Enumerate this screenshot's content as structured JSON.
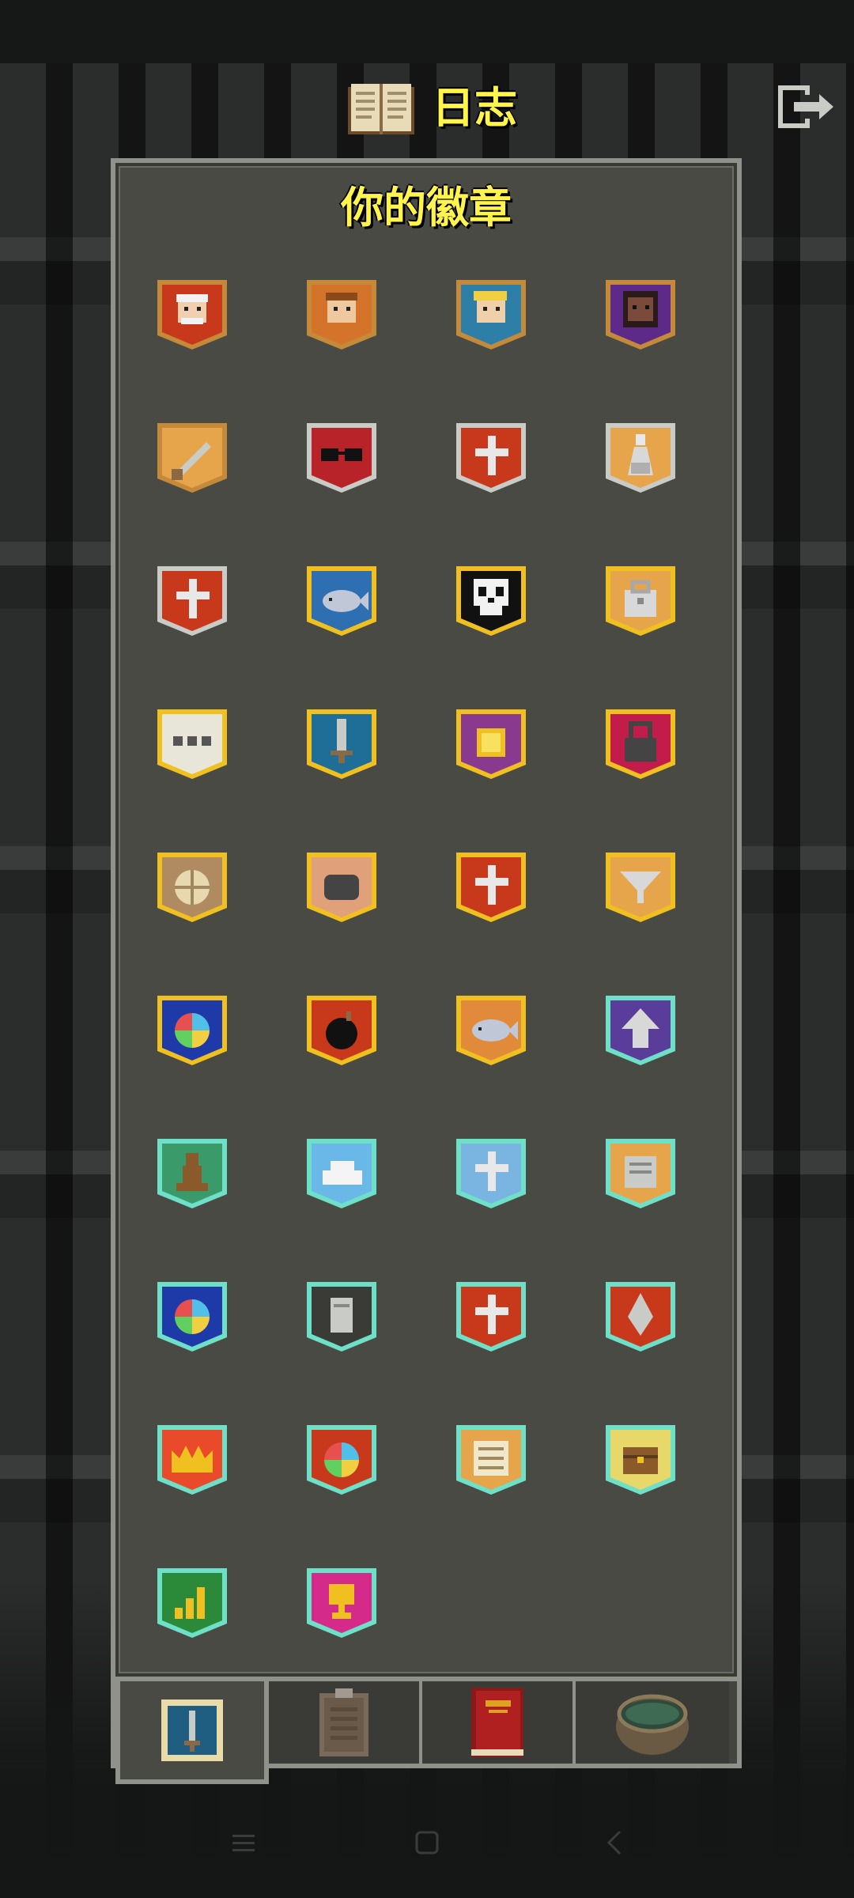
{
  "header": {
    "title": "日志",
    "book_icon": "journal-book-icon",
    "exit_icon": "exit-icon"
  },
  "panel": {
    "title": "你的徽章"
  },
  "badges": [
    {
      "name": "warrior-portrait-badge",
      "frame": "bronze",
      "bg": "#c8391b",
      "icon": "white-hair-face"
    },
    {
      "name": "mage-portrait-badge",
      "frame": "bronze",
      "bg": "#d4742a",
      "icon": "brown-hair-face"
    },
    {
      "name": "rogue-portrait-badge",
      "frame": "bronze",
      "bg": "#2d7fa8",
      "icon": "blond-face"
    },
    {
      "name": "huntress-portrait-badge",
      "frame": "bronze",
      "bg": "#5d2a8a",
      "icon": "dark-face"
    },
    {
      "name": "sword-badge",
      "frame": "bronze",
      "bg": "#e6a54a",
      "icon": "sword"
    },
    {
      "name": "glasses-badge",
      "frame": "silver",
      "bg": "#b8232a",
      "icon": "glasses"
    },
    {
      "name": "cross-silver-badge",
      "frame": "silver",
      "bg": "#c8391b",
      "icon": "cross"
    },
    {
      "name": "potion-badge",
      "frame": "silver",
      "bg": "#e6a54a",
      "icon": "potion"
    },
    {
      "name": "cross-banner-badge",
      "frame": "silver",
      "bg": "#c8391b",
      "icon": "cross"
    },
    {
      "name": "fish-badge",
      "frame": "gold",
      "bg": "#2d6fb0",
      "icon": "fish"
    },
    {
      "name": "skull-badge",
      "frame": "gold",
      "bg": "#111111",
      "icon": "skull"
    },
    {
      "name": "bag-badge",
      "frame": "gold",
      "bg": "#e6a54a",
      "icon": "bag"
    },
    {
      "name": "dots-badge",
      "frame": "gold",
      "bg": "#e8e6d8",
      "icon": "dots"
    },
    {
      "name": "dagger-badge",
      "frame": "gold",
      "bg": "#1f6e98",
      "icon": "dagger"
    },
    {
      "name": "gold-coin-badge",
      "frame": "gold",
      "bg": "#8a3a8e",
      "icon": "coin"
    },
    {
      "name": "lock-badge",
      "frame": "gold",
      "bg": "#c21d4a",
      "icon": "lock"
    },
    {
      "name": "shield-round-badge",
      "frame": "gold",
      "bg": "#b08a60",
      "icon": "round-shield"
    },
    {
      "name": "rock-badge",
      "frame": "gold",
      "bg": "#e0a07a",
      "icon": "rock"
    },
    {
      "name": "cross-gold-badge",
      "frame": "gold",
      "bg": "#c8391b",
      "icon": "cross"
    },
    {
      "name": "funnel-badge",
      "frame": "gold",
      "bg": "#e6a54a",
      "icon": "funnel"
    },
    {
      "name": "rainbow-orb-badge",
      "frame": "gold",
      "bg": "#1d3aa8",
      "icon": "orb"
    },
    {
      "name": "bomb-badge",
      "frame": "gold",
      "bg": "#c8391b",
      "icon": "bomb"
    },
    {
      "name": "shiny-fish-badge",
      "frame": "gold",
      "bg": "#e08a3a",
      "icon": "fish"
    },
    {
      "name": "arrow-up-badge",
      "frame": "teal",
      "bg": "#5a3c9a",
      "icon": "arrow-up"
    },
    {
      "name": "pawn-badge",
      "frame": "teal",
      "bg": "#3a9a6a",
      "icon": "pawn"
    },
    {
      "name": "cloud-badge",
      "frame": "teal",
      "bg": "#6ab8e8",
      "icon": "cloud"
    },
    {
      "name": "grave-badge",
      "frame": "teal",
      "bg": "#7ab4e0",
      "icon": "cross"
    },
    {
      "name": "scroll-badge",
      "frame": "teal",
      "bg": "#e6a54a",
      "icon": "scroll"
    },
    {
      "name": "orb-teal-badge",
      "frame": "teal",
      "bg": "#1d3aa8",
      "icon": "orb"
    },
    {
      "name": "tombstone-badge",
      "frame": "teal",
      "bg": "#3a3a36",
      "icon": "tombstone"
    },
    {
      "name": "cross-teal-badge",
      "frame": "teal",
      "bg": "#c8391b",
      "icon": "cross"
    },
    {
      "name": "flame-badge",
      "frame": "teal",
      "bg": "#c8391b",
      "icon": "drop"
    },
    {
      "name": "crown-badge",
      "frame": "teal",
      "bg": "#e84a2a",
      "icon": "crown"
    },
    {
      "name": "orb-red-badge",
      "frame": "teal",
      "bg": "#c8391b",
      "icon": "orb"
    },
    {
      "name": "list-badge",
      "frame": "teal",
      "bg": "#e6a54a",
      "icon": "list"
    },
    {
      "name": "chest-badge",
      "frame": "teal",
      "bg": "#e8d86a",
      "icon": "chest"
    },
    {
      "name": "chart-badge",
      "frame": "teal",
      "bg": "#2a8a3a",
      "icon": "bars"
    },
    {
      "name": "trophy-badge",
      "frame": "teal",
      "bg": "#d42a8a",
      "icon": "trophy"
    }
  ],
  "tabs": [
    {
      "name": "tab-badges",
      "icon": "badge-icon",
      "active": true
    },
    {
      "name": "tab-notes",
      "icon": "clipboard-icon",
      "active": false
    },
    {
      "name": "tab-catalog",
      "icon": "red-book-icon",
      "active": false
    },
    {
      "name": "tab-alchemy",
      "icon": "pot-icon",
      "active": false
    }
  ],
  "colors": {
    "title": "#fff44c",
    "frame_bronze": "#c48a3a",
    "frame_silver": "#c9cbc6",
    "frame_gold": "#f0c020",
    "frame_teal": "#6ee0c8"
  },
  "system_nav": [
    "menu-icon",
    "home-icon",
    "back-icon"
  ]
}
